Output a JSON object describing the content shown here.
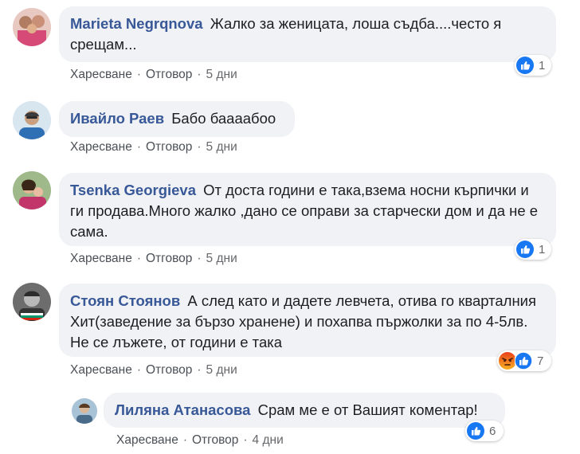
{
  "comments": [
    {
      "author": "Marieta Negrqnova",
      "text": "Жалко за женицата, лоша съдба....често я срещам...",
      "like": "Харесване",
      "reply": "Отговор",
      "time": "5 дни",
      "reaction_count": "1"
    },
    {
      "author": "Ивайло Раев",
      "text": "Бабо баааабоо",
      "like": "Харесване",
      "reply": "Отговор",
      "time": "5 дни"
    },
    {
      "author": "Tsenka Georgieva",
      "text": "От доста години е така,взема носни кърпички и ги продава.Много жалко ,дано се оправи за старчески дом и да не е сама.",
      "like": "Харесване",
      "reply": "Отговор",
      "time": "5 дни",
      "reaction_count": "1"
    },
    {
      "author": "Стоян Стоянов",
      "text": "А след като и дадете левчета, отива го кварталния Хит(заведение за бързо хранене) и похапва пържолки за по 4-5лв. Не се лъжете, от години е така",
      "like": "Харесване",
      "reply": "Отговор",
      "time": "5 дни",
      "reaction_count": "7"
    },
    {
      "author": "Лиляна Атанасова",
      "text": "Срам ме е от Вашият коментар!",
      "like": "Харесване",
      "reply": "Отговор",
      "time": "4 дни",
      "reaction_count": "6"
    }
  ],
  "separator": "·",
  "colors": {
    "author": "#385898",
    "bubble": "#f0f2f5",
    "like_blue": "#1877f2",
    "angry_orange": "#f0682a"
  },
  "icons": {
    "like": "thumbs-up-icon",
    "angry": "angry-face-icon"
  }
}
